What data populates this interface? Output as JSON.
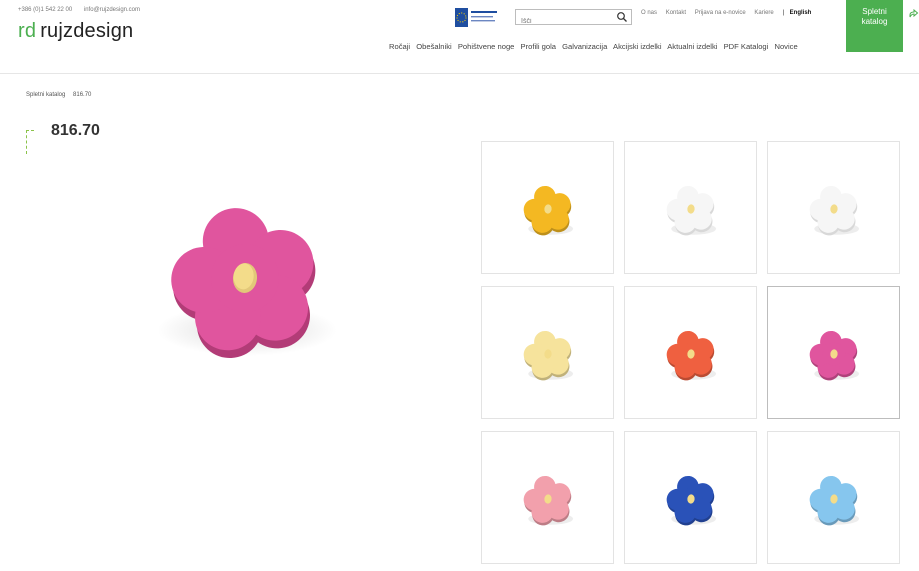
{
  "header": {
    "phone": "+386 (0)1 542 22 00",
    "email": "info@rujzdesign.com",
    "logo_mark": "rd",
    "logo_text": "rujzdesign",
    "search_placeholder": "Išči",
    "top_links": [
      "O nas",
      "Kontakt",
      "Prijava na e-novice",
      "Kariere"
    ],
    "language_separator": "|",
    "language": "English",
    "catalog_button": [
      "Spletni",
      "katalog"
    ],
    "nav": [
      "Ročaji",
      "Obešalniki",
      "Pohištvene noge",
      "Profili gola",
      "Galvanizacija",
      "Akcijski izdelki",
      "Aktualni izdelki",
      "PDF Katalogi",
      "Novice"
    ]
  },
  "breadcrumb": [
    "Spletni katalog",
    "816.70"
  ],
  "product": {
    "title": "816.70",
    "main_color": "#e0559e",
    "thumbnails": [
      {
        "color": "#f4b822",
        "active": false
      },
      {
        "color": "#f6f6f6",
        "active": false
      },
      {
        "color": "#f6f6f6",
        "active": false
      },
      {
        "color": "#f6e39c",
        "active": false
      },
      {
        "color": "#ef6040",
        "active": false
      },
      {
        "color": "#e0559e",
        "active": true
      },
      {
        "color": "#f2a0ac",
        "active": false
      },
      {
        "color": "#2a52b8",
        "active": false
      },
      {
        "color": "#86c6ee",
        "active": false
      }
    ]
  },
  "colors": {
    "brand_green": "#4caf50",
    "center_cream": "#f3dc8a"
  }
}
